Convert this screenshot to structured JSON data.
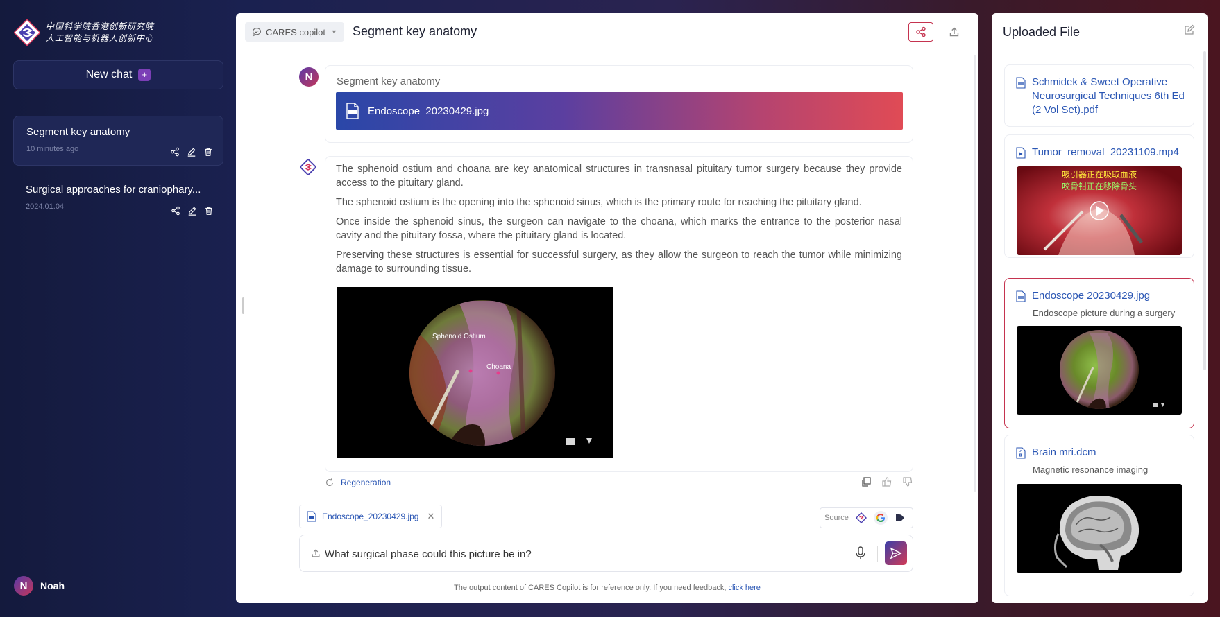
{
  "sidebar": {
    "org_name": [
      "中国科学院香港创新研究院",
      "人工智能与机器人创新中心"
    ],
    "new_chat_label": "New chat",
    "new_chat_plus": "+",
    "chats": [
      {
        "title": "Segment key anatomy",
        "time": "10 minutes ago"
      },
      {
        "title": "Surgical approaches for craniophary...",
        "time": "2024.01.04"
      }
    ],
    "user": {
      "initial": "N",
      "name": "Noah"
    }
  },
  "main": {
    "model_select": "CARES copilot",
    "title": "Segment key anatomy",
    "user_message": {
      "avatar_initial": "N",
      "text": "Segment key anatomy",
      "attachment": "Endoscope_20230429.jpg"
    },
    "bot_message": {
      "paragraphs": [
        "The sphenoid ostium and choana are key anatomical structures in transnasal pituitary tumor surgery because they provide access to the pituitary gland.",
        "The sphenoid ostium is the opening into the sphenoid sinus, which is the primary route for reaching the pituitary gland.",
        "Once inside the sphenoid sinus, the surgeon can navigate to the choana, which marks the entrance to the posterior nasal cavity and the pituitary fossa, where the pituitary gland is located.",
        "Preserving these structures is essential for successful surgery, as they allow the surgeon to reach the tumor while minimizing damage to surrounding tissue."
      ],
      "image_labels": {
        "sphenoid": "Sphenoid Ostium",
        "choana": "Choana"
      }
    },
    "regeneration_label": "Regeneration",
    "attachment_chip": "Endoscope_20230429.jpg",
    "source_label": "Source",
    "input": {
      "value": "What surgical phase could this picture be in?"
    },
    "disclaimer": "The output content of CARES Copilot is for reference only. If you need feedback,",
    "disclaimer_link": "click here"
  },
  "right_panel": {
    "title": "Uploaded File",
    "files": [
      {
        "name": "Schmidek & Sweet Operative Neurosurgical Techniques 6th Ed (2 Vol Set).pdf",
        "type": "pdf"
      },
      {
        "name": "Tumor_removal_20231109.mp4",
        "type": "video",
        "overlay_lines": [
          "吸引器正在吸取血液",
          "咬骨钳正在移除骨头"
        ]
      },
      {
        "name": "Endoscope 20230429.jpg",
        "type": "image",
        "desc": "Endoscope picture during a surgery"
      },
      {
        "name": "Brain mri.dcm",
        "type": "dicom",
        "desc": "Magnetic resonance imaging"
      }
    ]
  },
  "colors": {
    "accent": "#c5334f",
    "link": "#2a56b4",
    "sidebar_bg": "#141a3d"
  }
}
